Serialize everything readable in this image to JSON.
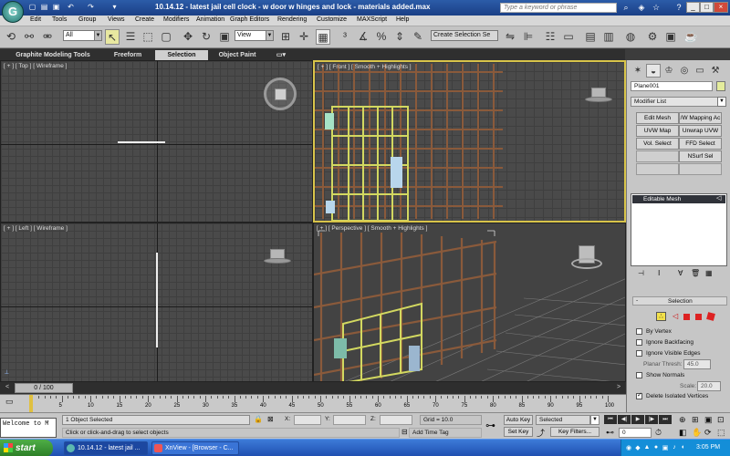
{
  "app": {
    "logo_glyph": "G",
    "title": "10.14.12 - latest jail cell clock - w door w hinges and lock - materials added.max",
    "search_placeholder": "Type a keyword or phrase"
  },
  "menu": [
    "Edit",
    "Tools",
    "Group",
    "Views",
    "Create",
    "Modifiers",
    "Animation",
    "Graph Editors",
    "Rendering",
    "Customize",
    "MAXScript",
    "Help"
  ],
  "toolbar": {
    "filter_dropdown": "All",
    "refcoord_dropdown": "View",
    "selection_set": "Create Selection Se"
  },
  "ribbon": {
    "tabs": [
      "Graphite Modeling Tools",
      "Freeform",
      "Selection",
      "Object Paint"
    ],
    "active_tab": "Selection"
  },
  "viewports": {
    "top": "[ + ] [ Top ] [ Wireframe ]",
    "front": "[ + ] [ Front ] [ Smooth + Highlights ]",
    "left": "[ + ] [ Left ] [ Wireframe ]",
    "perspective": "[ + ] [ Perspective ] [ Smooth + Highlights ]"
  },
  "command_panel": {
    "object_name": "Plane001",
    "modifier_list": "Modifier List",
    "modifier_buttons": [
      [
        "Edit Mesh",
        "/W Mapping Ac"
      ],
      [
        "UVW Map",
        "Unwrap UVW"
      ],
      [
        "Vol. Select",
        "FFD Select"
      ],
      [
        "",
        "NSurf Sel"
      ]
    ],
    "stack_item": "Editable Mesh",
    "rollout_title": "Selection",
    "rollout_collapse": "-",
    "checks": {
      "by_vertex": "By Vertex",
      "ignore_backfacing": "Ignore Backfacing",
      "ignore_visible_edges": "Ignore Visible Edges",
      "planar_thresh_label": "Planar Thresh:",
      "planar_thresh_value": "45.0",
      "show_normals": "Show Normals",
      "scale_label": "Scale:",
      "scale_value": "20.0",
      "delete_isolated": "Delete Isolated Vertices"
    },
    "delete_isolated_checked": true
  },
  "timeline": {
    "frame_readout": "0 / 100",
    "ticks": [
      "5",
      "10",
      "15",
      "20",
      "25",
      "30",
      "35",
      "40",
      "45",
      "50",
      "55",
      "60",
      "65",
      "70",
      "75",
      "80",
      "85",
      "90",
      "95",
      "100"
    ]
  },
  "status": {
    "maxscript_listener": "Welcome to M",
    "selection_info": "1 Object Selected",
    "prompt": "Click or click-and-drag to select objects",
    "x_label": "X:",
    "y_label": "Y:",
    "z_label": "Z:",
    "grid": "Grid = 10.0",
    "add_time_tag": "Add Time Tag",
    "auto_key": "Auto Key",
    "set_key": "Set Key",
    "key_mode": "Selected",
    "key_filters": "Key Filters...",
    "current_frame": "0"
  },
  "taskbar": {
    "start": "start",
    "tasks": [
      "10.14.12 - latest jail ...",
      "XnView - [Browser - C..."
    ],
    "active_task": 0,
    "clock": "3:05 PM"
  },
  "colors": {
    "titlebar": "#2c5ca8",
    "viewport_bg": "#4a4a4a",
    "wire_brown": "#8a5a3b",
    "door_yellow": "#d2d860",
    "active_viewport_border": "#d8c44a",
    "start_green": "#3a9a33"
  }
}
